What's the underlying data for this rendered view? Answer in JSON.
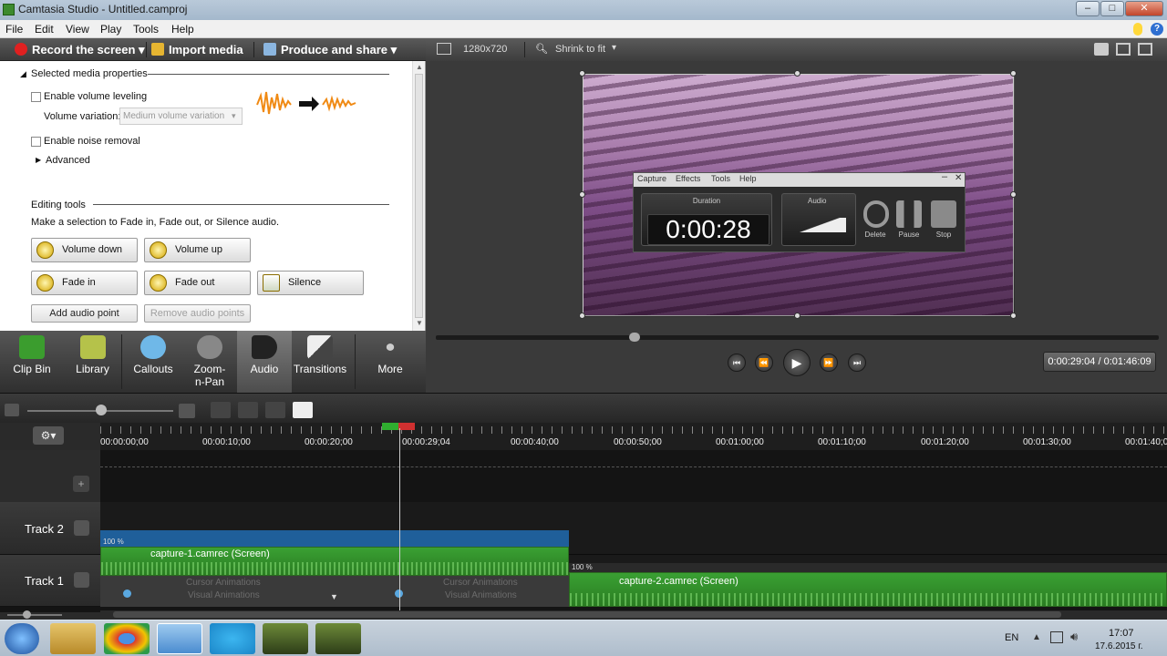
{
  "window": {
    "title": "Camtasia Studio - Untitled.camproj",
    "controls": [
      "–",
      "□",
      "✕"
    ]
  },
  "menubar": [
    "File",
    "Edit",
    "View",
    "Play",
    "Tools",
    "Help"
  ],
  "toolbar": {
    "record": "Record the screen",
    "import": "Import media",
    "produce": "Produce and share"
  },
  "props": {
    "section1": "Selected media properties",
    "volume_leveling": "Enable volume leveling",
    "volume_variation_label": "Volume variation:",
    "volume_variation_value": "Medium volume variation",
    "noise_removal": "Enable noise removal",
    "advanced": "Advanced",
    "section2": "Editing tools",
    "hint": "Make a selection to Fade in, Fade out, or Silence audio.",
    "buttons": {
      "volume_down": "Volume down",
      "volume_up": "Volume up",
      "fade_in": "Fade in",
      "fade_out": "Fade out",
      "silence": "Silence",
      "add_point": "Add audio point",
      "remove_points": "Remove audio points"
    }
  },
  "tabs": [
    {
      "label": "Clip Bin",
      "icon": "film-icon"
    },
    {
      "label": "Library",
      "icon": "folder-icon"
    },
    {
      "label": "Callouts",
      "icon": "speech-bubble-icon"
    },
    {
      "label": "Zoom-n-Pan",
      "icon": "magnifier-icon"
    },
    {
      "label": "Audio",
      "icon": "speaker-icon"
    },
    {
      "label": "Transitions",
      "icon": "transition-icon"
    },
    {
      "label": "More",
      "icon": "more-icon"
    }
  ],
  "preview": {
    "dimensions": "1280x720",
    "zoom": "Shrink to fit",
    "time": "0:00:29:04 / 0:01:46:09",
    "recorder": {
      "menu": [
        "Capture",
        "Effects",
        "Tools",
        "Help"
      ],
      "duration_label": "Duration",
      "duration": "0:00:28",
      "audio_label": "Audio",
      "delete": "Delete",
      "pause": "Pause",
      "stop": "Stop"
    }
  },
  "timeline": {
    "ticks": [
      "00:00:00;00",
      "00:00:10;00",
      "00:00:20;00",
      "00:00:29;04",
      "00:00:40;00",
      "00:00:50;00",
      "00:01:00;00",
      "00:01:10;00",
      "00:01:20;00",
      "00:01:30;00",
      "00:01:40;00"
    ],
    "tracks": [
      "Track 2",
      "Track 1"
    ],
    "clip1": "capture-1.camrec (Screen)",
    "clip2": "capture-2.camrec (Screen)",
    "clip_pct": "100 %",
    "cursor_anim": "Cursor Animations",
    "visual_anim": "Visual Animations"
  },
  "taskbar": {
    "lang": "EN",
    "time": "17:07",
    "date": "17.6.2015 г."
  }
}
